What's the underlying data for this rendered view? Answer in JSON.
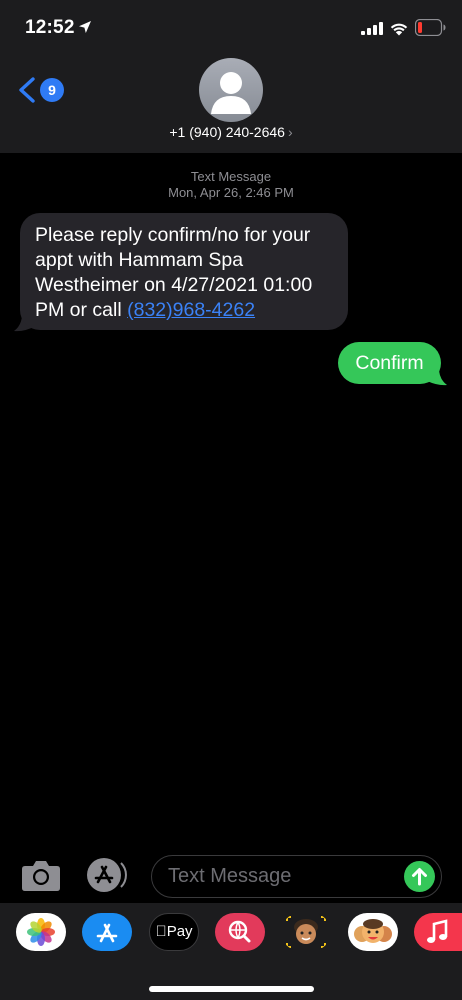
{
  "status_bar": {
    "time": "12:52"
  },
  "header": {
    "back_badge": "9",
    "contact_number": "+1 (940) 240-2646",
    "contact_chevron": "›"
  },
  "conversation": {
    "meta_kind": "Text Message",
    "meta_datetime": "Mon, Apr 26, 2:46 PM",
    "incoming": {
      "text": "Please reply confirm/no for your appt with Hammam Spa Westheimer on 4/27/2021 01:00 PM or call ",
      "phone_link": "(832)968-4262"
    },
    "outgoing": {
      "text": "Confirm"
    }
  },
  "input_bar": {
    "placeholder": "Text Message"
  },
  "app_strip": {
    "apps": [
      {
        "icon": "photos-icon"
      },
      {
        "icon": "app-store-icon"
      },
      {
        "icon": "apple-pay-icon",
        "label": "Pay"
      },
      {
        "icon": "web-search-icon"
      },
      {
        "icon": "memoji-icon"
      },
      {
        "icon": "memoji-stickers-icon"
      },
      {
        "icon": "music-icon"
      }
    ]
  },
  "colors": {
    "header_bg": "#1c1c1e",
    "incoming_bubble": "#26252a",
    "outgoing_bubble": "#35c759",
    "link": "#3b82f6",
    "badge": "#2f7bf5",
    "battery_low": "#ff3b30"
  }
}
